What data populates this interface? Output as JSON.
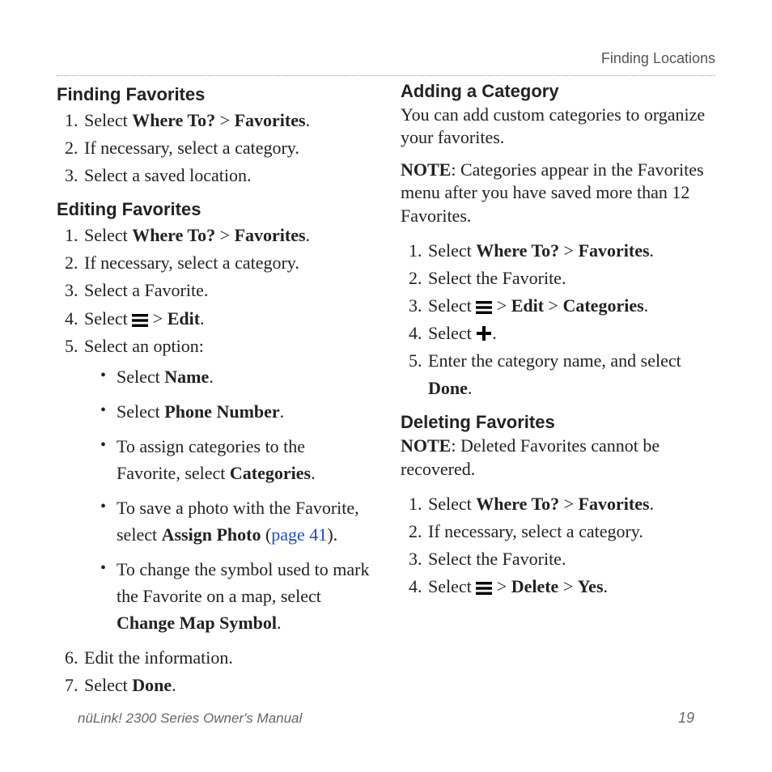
{
  "header": {
    "section": "Finding Locations"
  },
  "footer": {
    "manual": "nüLink! 2300 Series Owner's Manual",
    "page": "19"
  },
  "glyph": {
    "gt": " > "
  },
  "finding": {
    "title": "Finding Favorites",
    "s1a": "Select ",
    "s1b": "Where To?",
    "s1c": "Favorites",
    "s1d": ".",
    "s2": "If necessary, select a category.",
    "s3": "Select a saved location."
  },
  "editing": {
    "title": "Editing Favorites",
    "s1a": "Select ",
    "s1b": "Where To?",
    "s1c": "Favorites",
    "s1d": ".",
    "s2": "If necessary, select a category.",
    "s3": "Select a Favorite.",
    "s4a": "Select ",
    "s4b": "Edit",
    "s4c": ".",
    "s5": "Select an option:",
    "b1a": "Select ",
    "b1b": "Name",
    "b1c": ".",
    "b2a": "Select ",
    "b2b": "Phone Number",
    "b2c": ".",
    "b3a": "To assign categories to the Favorite, select ",
    "b3b": "Categories",
    "b3c": ".",
    "b4a": "To save a photo with the Favorite, select ",
    "b4b": "Assign Photo",
    "b4c": " (",
    "b4d": "page 41",
    "b4e": ").",
    "b5a": "To change the symbol used to mark the Favorite on a map, select ",
    "b5b": "Change Map Symbol",
    "b5c": ".",
    "s6": "Edit the information.",
    "s7a": "Select ",
    "s7b": "Done",
    "s7c": "."
  },
  "adding": {
    "title": "Adding a Category",
    "intro": "You can add custom categories to organize your favorites.",
    "note_label": "NOTE",
    "note_text": ": Categories appear in the Favorites menu after you have saved more than 12 Favorites.",
    "s1a": "Select ",
    "s1b": "Where To?",
    "s1c": "Favorites",
    "s1d": ".",
    "s2": "Select the Favorite.",
    "s3a": "Select ",
    "s3b": "Edit",
    "s3c": "Categories",
    "s3d": ".",
    "s4a": "Select ",
    "s4b": ".",
    "s5a": "Enter the category name, and select ",
    "s5b": "Done",
    "s5c": "."
  },
  "deleting": {
    "title": "Deleting Favorites",
    "note_label": "NOTE",
    "note_text": ": Deleted Favorites cannot be recovered.",
    "s1a": "Select ",
    "s1b": "Where To?",
    "s1c": "Favorites",
    "s1d": ".",
    "s2": "If necessary, select a category.",
    "s3": "Select the Favorite.",
    "s4a": "Select ",
    "s4b": "Delete",
    "s4c": "Yes",
    "s4d": "."
  }
}
